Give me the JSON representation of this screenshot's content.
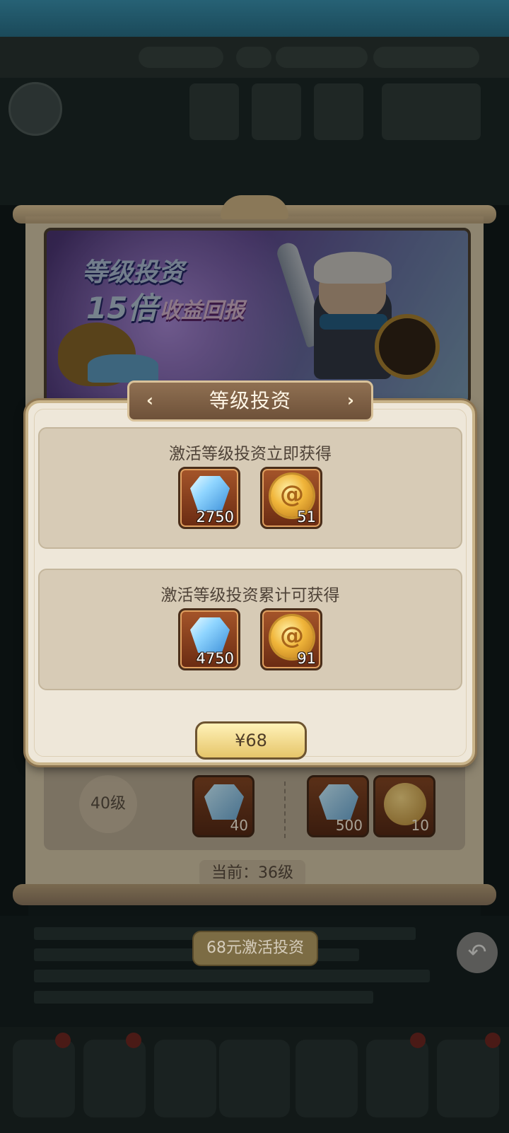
{
  "modal": {
    "title": "等级投资",
    "left_arrow_glyph": "‹",
    "right_arrow_glyph": "›",
    "sections": [
      {
        "heading": "激活等级投资立即获得",
        "items": [
          {
            "icon": "diamond-gem-icon",
            "count": "2750"
          },
          {
            "icon": "gold-medal-icon",
            "count": "51"
          }
        ]
      },
      {
        "heading": "激活等级投资累计可获得",
        "items": [
          {
            "icon": "diamond-gem-icon",
            "count": "4750"
          },
          {
            "icon": "gold-medal-icon",
            "count": "91"
          }
        ]
      }
    ],
    "price_label": "¥68"
  },
  "banner": {
    "title_line1": "等级投资",
    "title_line2": "15倍",
    "title_line3": "收益回报"
  },
  "level_row": {
    "level_label": "40级",
    "free_reward": {
      "icon": "diamond-gem-icon",
      "count": "40"
    },
    "paid_rewards": [
      {
        "icon": "diamond-gem-icon",
        "count": "500"
      },
      {
        "icon": "gold-medal-icon",
        "count": "10"
      }
    ]
  },
  "current_level": "当前：36级",
  "activate_button": "68元激活投资",
  "back_icon_glyph": "↶",
  "colors": {
    "modal_bg": "#eee7d9",
    "section_bg": "#d7cbb6",
    "title_plate": "#7d5e43",
    "price_button": "#f1d98c",
    "item_frame": "#8a401c"
  }
}
